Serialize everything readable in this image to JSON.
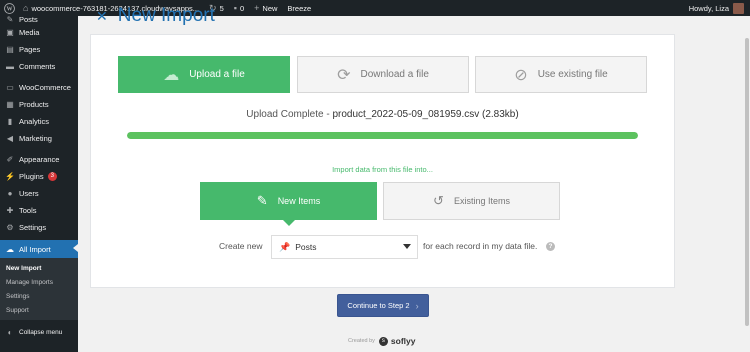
{
  "admin_bar": {
    "site_name": "woocommerce-763181-2634137.cloudwaysapps...",
    "updates_count": "5",
    "comments_count": "0",
    "new_label": "New",
    "breeze_label": "Breeze",
    "greeting": "Howdy, Liza"
  },
  "sidebar": {
    "items": [
      {
        "label": "Posts",
        "icon": "pin-icon"
      },
      {
        "label": "Media",
        "icon": "media-icon"
      },
      {
        "label": "Pages",
        "icon": "pages-icon"
      },
      {
        "label": "Comments",
        "icon": "comments-icon"
      },
      {
        "label": "WooCommerce",
        "icon": "woocommerce-icon"
      },
      {
        "label": "Products",
        "icon": "products-icon"
      },
      {
        "label": "Analytics",
        "icon": "analytics-icon"
      },
      {
        "label": "Marketing",
        "icon": "marketing-icon"
      },
      {
        "label": "Appearance",
        "icon": "appearance-icon"
      },
      {
        "label": "Plugins",
        "icon": "plugins-icon",
        "badge": "3"
      },
      {
        "label": "Users",
        "icon": "users-icon"
      },
      {
        "label": "Tools",
        "icon": "tools-icon"
      },
      {
        "label": "Settings",
        "icon": "settings-icon"
      },
      {
        "label": "All Import",
        "icon": "all-import-icon"
      }
    ],
    "submenu": [
      "New Import",
      "Manage Imports",
      "Settings",
      "Support"
    ],
    "collapse_label": "Collapse menu"
  },
  "page": {
    "title": "New Import"
  },
  "import_methods": {
    "upload": "Upload a file",
    "download": "Download a file",
    "existing": "Use existing file",
    "selected": "upload"
  },
  "upload": {
    "status_prefix": "Upload Complete",
    "separator": " - ",
    "filename": "product_2022-05-09_081959.csv (2.83kb)",
    "progress": 1.0
  },
  "import_into": {
    "label": "Import data from this file into...",
    "new_items": "New Items",
    "existing_items": "Existing Items",
    "selected": "new_items"
  },
  "create": {
    "prefix": "Create new",
    "selected_type": "Posts",
    "suffix": "for each record in my data file.",
    "help": "?"
  },
  "continue_label": "Continue to Step 2",
  "footer": {
    "created_by": "Created by",
    "brand": "soflyy"
  },
  "colors": {
    "accent_green": "#46b96c",
    "wp_blue": "#2271b1",
    "continue_blue": "#425f9c"
  }
}
